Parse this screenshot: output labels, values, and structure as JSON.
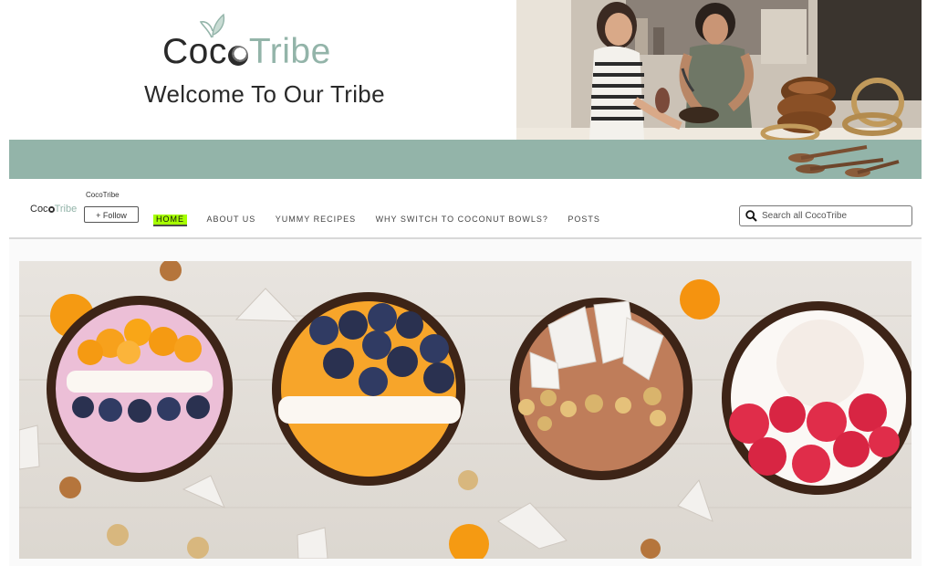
{
  "hero": {
    "brand_coco": "Coc",
    "brand_tribe": "Tribe",
    "tagline": "Welcome To Our Tribe"
  },
  "nav": {
    "logo_coco": "Coc",
    "logo_tribe": "Tribe",
    "store_name": "CocoTribe",
    "follow_label": "+ Follow",
    "items": [
      {
        "label": "HOME",
        "active": true
      },
      {
        "label": "ABOUT US",
        "active": false
      },
      {
        "label": "YUMMY RECIPES",
        "active": false
      },
      {
        "label": "WHY SWITCH TO COCONUT BOWLS?",
        "active": false
      },
      {
        "label": "POSTS",
        "active": false
      }
    ],
    "search_placeholder": "Search all CocoTribe"
  },
  "colors": {
    "brand_green": "#93b4a9",
    "active_highlight": "#a6ff00"
  }
}
